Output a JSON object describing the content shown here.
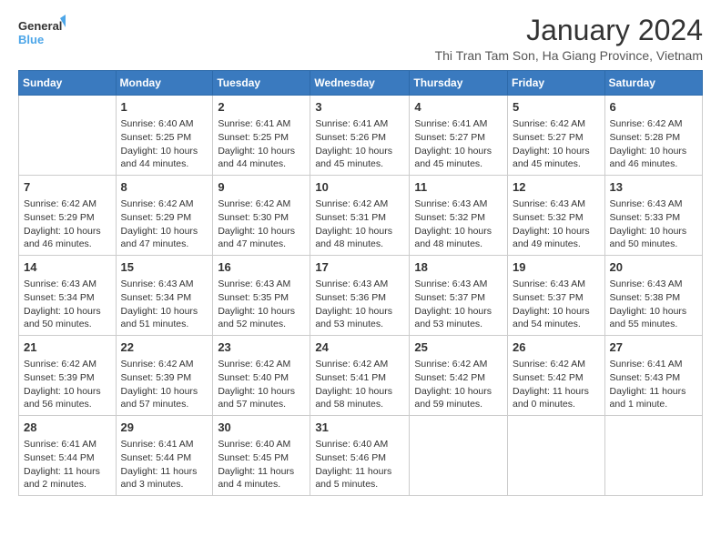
{
  "logo": {
    "line1": "General",
    "line2": "Blue"
  },
  "title": "January 2024",
  "subtitle": "Thi Tran Tam Son, Ha Giang Province, Vietnam",
  "weekdays": [
    "Sunday",
    "Monday",
    "Tuesday",
    "Wednesday",
    "Thursday",
    "Friday",
    "Saturday"
  ],
  "weeks": [
    [
      {
        "day": null,
        "sunrise": null,
        "sunset": null,
        "daylight": null
      },
      {
        "day": "1",
        "sunrise": "6:40 AM",
        "sunset": "5:25 PM",
        "daylight": "10 hours and 44 minutes."
      },
      {
        "day": "2",
        "sunrise": "6:41 AM",
        "sunset": "5:25 PM",
        "daylight": "10 hours and 44 minutes."
      },
      {
        "day": "3",
        "sunrise": "6:41 AM",
        "sunset": "5:26 PM",
        "daylight": "10 hours and 45 minutes."
      },
      {
        "day": "4",
        "sunrise": "6:41 AM",
        "sunset": "5:27 PM",
        "daylight": "10 hours and 45 minutes."
      },
      {
        "day": "5",
        "sunrise": "6:42 AM",
        "sunset": "5:27 PM",
        "daylight": "10 hours and 45 minutes."
      },
      {
        "day": "6",
        "sunrise": "6:42 AM",
        "sunset": "5:28 PM",
        "daylight": "10 hours and 46 minutes."
      }
    ],
    [
      {
        "day": "7",
        "sunrise": "6:42 AM",
        "sunset": "5:29 PM",
        "daylight": "10 hours and 46 minutes."
      },
      {
        "day": "8",
        "sunrise": "6:42 AM",
        "sunset": "5:29 PM",
        "daylight": "10 hours and 47 minutes."
      },
      {
        "day": "9",
        "sunrise": "6:42 AM",
        "sunset": "5:30 PM",
        "daylight": "10 hours and 47 minutes."
      },
      {
        "day": "10",
        "sunrise": "6:42 AM",
        "sunset": "5:31 PM",
        "daylight": "10 hours and 48 minutes."
      },
      {
        "day": "11",
        "sunrise": "6:43 AM",
        "sunset": "5:32 PM",
        "daylight": "10 hours and 48 minutes."
      },
      {
        "day": "12",
        "sunrise": "6:43 AM",
        "sunset": "5:32 PM",
        "daylight": "10 hours and 49 minutes."
      },
      {
        "day": "13",
        "sunrise": "6:43 AM",
        "sunset": "5:33 PM",
        "daylight": "10 hours and 50 minutes."
      }
    ],
    [
      {
        "day": "14",
        "sunrise": "6:43 AM",
        "sunset": "5:34 PM",
        "daylight": "10 hours and 50 minutes."
      },
      {
        "day": "15",
        "sunrise": "6:43 AM",
        "sunset": "5:34 PM",
        "daylight": "10 hours and 51 minutes."
      },
      {
        "day": "16",
        "sunrise": "6:43 AM",
        "sunset": "5:35 PM",
        "daylight": "10 hours and 52 minutes."
      },
      {
        "day": "17",
        "sunrise": "6:43 AM",
        "sunset": "5:36 PM",
        "daylight": "10 hours and 53 minutes."
      },
      {
        "day": "18",
        "sunrise": "6:43 AM",
        "sunset": "5:37 PM",
        "daylight": "10 hours and 53 minutes."
      },
      {
        "day": "19",
        "sunrise": "6:43 AM",
        "sunset": "5:37 PM",
        "daylight": "10 hours and 54 minutes."
      },
      {
        "day": "20",
        "sunrise": "6:43 AM",
        "sunset": "5:38 PM",
        "daylight": "10 hours and 55 minutes."
      }
    ],
    [
      {
        "day": "21",
        "sunrise": "6:42 AM",
        "sunset": "5:39 PM",
        "daylight": "10 hours and 56 minutes."
      },
      {
        "day": "22",
        "sunrise": "6:42 AM",
        "sunset": "5:39 PM",
        "daylight": "10 hours and 57 minutes."
      },
      {
        "day": "23",
        "sunrise": "6:42 AM",
        "sunset": "5:40 PM",
        "daylight": "10 hours and 57 minutes."
      },
      {
        "day": "24",
        "sunrise": "6:42 AM",
        "sunset": "5:41 PM",
        "daylight": "10 hours and 58 minutes."
      },
      {
        "day": "25",
        "sunrise": "6:42 AM",
        "sunset": "5:42 PM",
        "daylight": "10 hours and 59 minutes."
      },
      {
        "day": "26",
        "sunrise": "6:42 AM",
        "sunset": "5:42 PM",
        "daylight": "11 hours and 0 minutes."
      },
      {
        "day": "27",
        "sunrise": "6:41 AM",
        "sunset": "5:43 PM",
        "daylight": "11 hours and 1 minute."
      }
    ],
    [
      {
        "day": "28",
        "sunrise": "6:41 AM",
        "sunset": "5:44 PM",
        "daylight": "11 hours and 2 minutes."
      },
      {
        "day": "29",
        "sunrise": "6:41 AM",
        "sunset": "5:44 PM",
        "daylight": "11 hours and 3 minutes."
      },
      {
        "day": "30",
        "sunrise": "6:40 AM",
        "sunset": "5:45 PM",
        "daylight": "11 hours and 4 minutes."
      },
      {
        "day": "31",
        "sunrise": "6:40 AM",
        "sunset": "5:46 PM",
        "daylight": "11 hours and 5 minutes."
      },
      {
        "day": null,
        "sunrise": null,
        "sunset": null,
        "daylight": null
      },
      {
        "day": null,
        "sunrise": null,
        "sunset": null,
        "daylight": null
      },
      {
        "day": null,
        "sunrise": null,
        "sunset": null,
        "daylight": null
      }
    ]
  ],
  "labels": {
    "sunrise": "Sunrise: ",
    "sunset": "Sunset: ",
    "daylight": "Daylight: "
  }
}
